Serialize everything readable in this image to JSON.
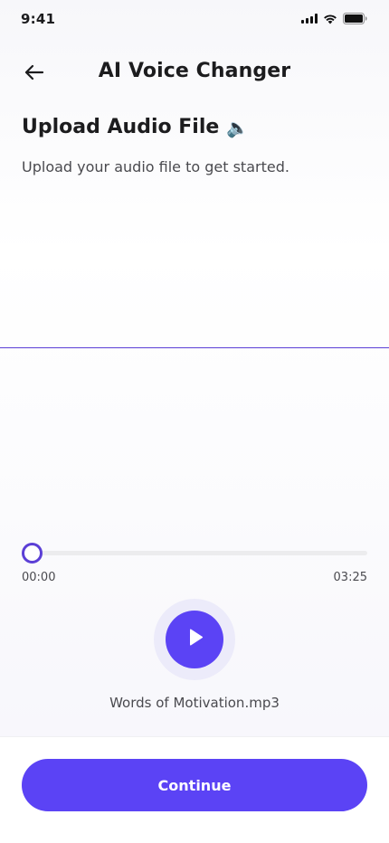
{
  "status_bar": {
    "time": "9:41",
    "icons": [
      "signal-icon",
      "wifi-icon",
      "battery-icon"
    ]
  },
  "header": {
    "back_icon": "arrow-left-icon",
    "title": "AI Voice Changer"
  },
  "upload": {
    "title": "Upload Audio File",
    "title_emoji": "🔈",
    "subtitle": "Upload your audio file to get started."
  },
  "player": {
    "current_time": "00:00",
    "total_time": "03:25",
    "progress": 0,
    "play_icon": "play-icon",
    "file_name": "Words of Motivation.mp3"
  },
  "footer": {
    "continue_label": "Continue"
  },
  "colors": {
    "accent": "#5b43f5",
    "accent_soft": "#ecebfa",
    "divider": "#5b3fd6"
  }
}
